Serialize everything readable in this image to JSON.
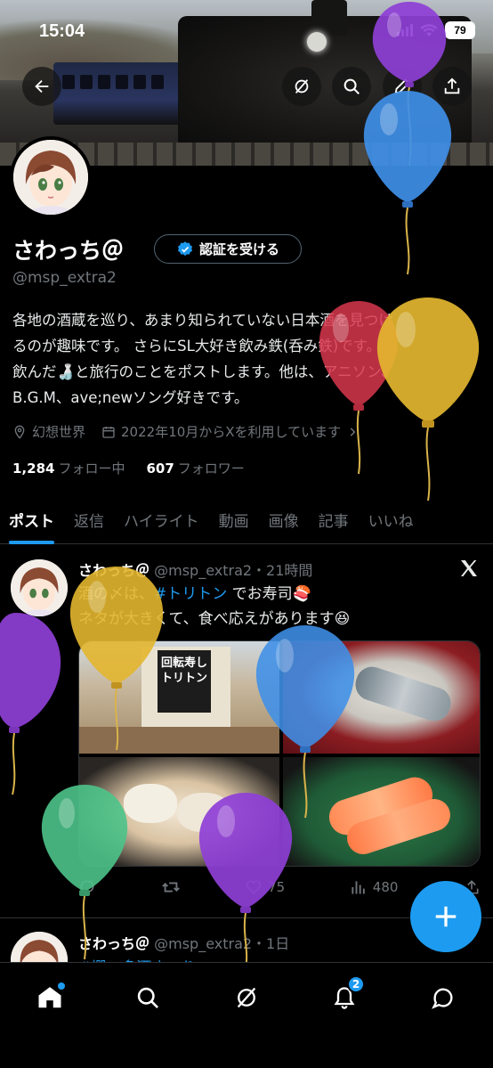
{
  "status_bar": {
    "time": "15:04",
    "battery": "79"
  },
  "profile": {
    "name": "さわっち＠",
    "verify_label": "認証を受ける",
    "handle": "@msp_extra2",
    "bio_lines": [
      "各地の酒蔵を巡り、あまり知られていない日本酒を見つけ",
      "るのが趣味です。 さらにSL大好き飲み鉄(呑み鉄)です。",
      "飲んだ🍶と旅行のことをポストします。他は、アニソン、",
      "B.G.M、ave;newソング好きです。"
    ],
    "location": "幻想世界",
    "joined": "2022年10月からXを利用しています",
    "following_count": "1,284",
    "following_label": "フォロー中",
    "followers_count": "607",
    "followers_label": "フォロワー"
  },
  "tabs": [
    "ポスト",
    "返信",
    "ハイライト",
    "動画",
    "画像",
    "記事",
    "いいね"
  ],
  "tweets": [
    {
      "display_name": "さわっち＠",
      "handle_time": "@msp_extra2・21時間",
      "text_line1_pre": "酒の〆は、",
      "hashtag": "#トリトン",
      "text_line1_post": " でお寿司🍣",
      "text_line2": "ネタが大きくて、食べ応えがあります😆",
      "media_sign": "回転寿しトリトン",
      "likes": "75",
      "views": "480"
    },
    {
      "display_name": "さわっち＠",
      "handle_time": "@msp_extra2・1日",
      "text_preview": "#燗二多酒まつり"
    }
  ],
  "nav": {
    "notifications_badge": "2"
  },
  "colors": {
    "accent": "#1d9bf0",
    "background": "#000000",
    "muted": "#71767b",
    "balloons": [
      "#8e3fd6",
      "#3f8fe8",
      "#d8374d",
      "#e3b62f",
      "#4cc38a"
    ]
  }
}
